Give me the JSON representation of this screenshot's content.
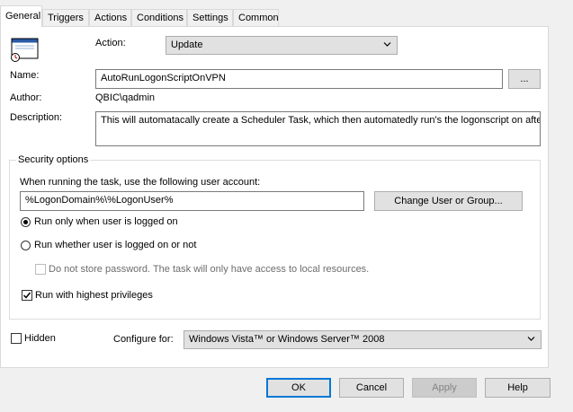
{
  "tabs": [
    "General",
    "Triggers",
    "Actions",
    "Conditions",
    "Settings",
    "Common"
  ],
  "icon": "scheduled-task-icon",
  "action": {
    "label": "Action:",
    "value": "Update"
  },
  "name": {
    "label": "Name:",
    "value": "AutoRunLogonScriptOnVPN",
    "browse_label": "..."
  },
  "author": {
    "label": "Author:",
    "value": "QBIC\\qadmin"
  },
  "description": {
    "label": "Description:",
    "value": "This will automatacally create a Scheduler Task, which then automatedly run's the logonscript on after"
  },
  "security": {
    "title": "Security options",
    "prompt": "When running the task, use the following user account:",
    "account": "%LogonDomain%\\%LogonUser%",
    "change_button": "Change User or Group...",
    "radio_logged_on": "Run only when user is logged on",
    "radio_whether": "Run whether user is logged on or not",
    "radio_selected": "logged_on",
    "no_store_password": "Do not store password. The task will only have access to local resources.",
    "no_store_password_checked": false,
    "highest_privileges": "Run with highest privileges",
    "highest_privileges_checked": true
  },
  "hidden": {
    "label": "Hidden",
    "checked": false
  },
  "configure": {
    "label": "Configure for:",
    "value": "Windows Vista™ or Windows Server™ 2008"
  },
  "buttons": {
    "ok": "OK",
    "cancel": "Cancel",
    "apply": "Apply",
    "help": "Help"
  }
}
